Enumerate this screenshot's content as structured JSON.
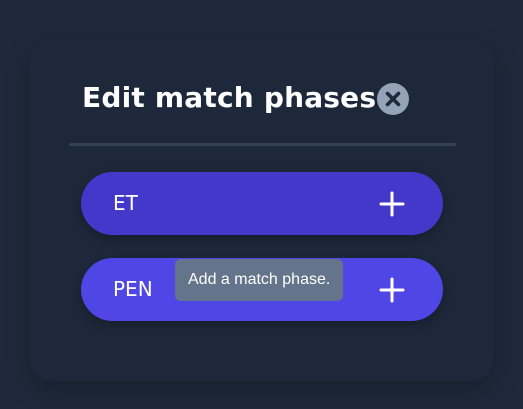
{
  "dialog": {
    "title": "Edit match phases",
    "close_icon": "close-x-icon"
  },
  "phases": [
    {
      "label": "ET",
      "action_icon": "plus-icon",
      "color": "#4338ca"
    },
    {
      "label": "PEN",
      "action_icon": "plus-icon",
      "color": "#4f46e5"
    }
  ],
  "tooltip": {
    "text": "Add a match phase."
  },
  "colors": {
    "background": "#1e293b",
    "accent": "#4f46e5",
    "close_button": "#94a3b8",
    "tooltip_bg": "#64748b"
  }
}
